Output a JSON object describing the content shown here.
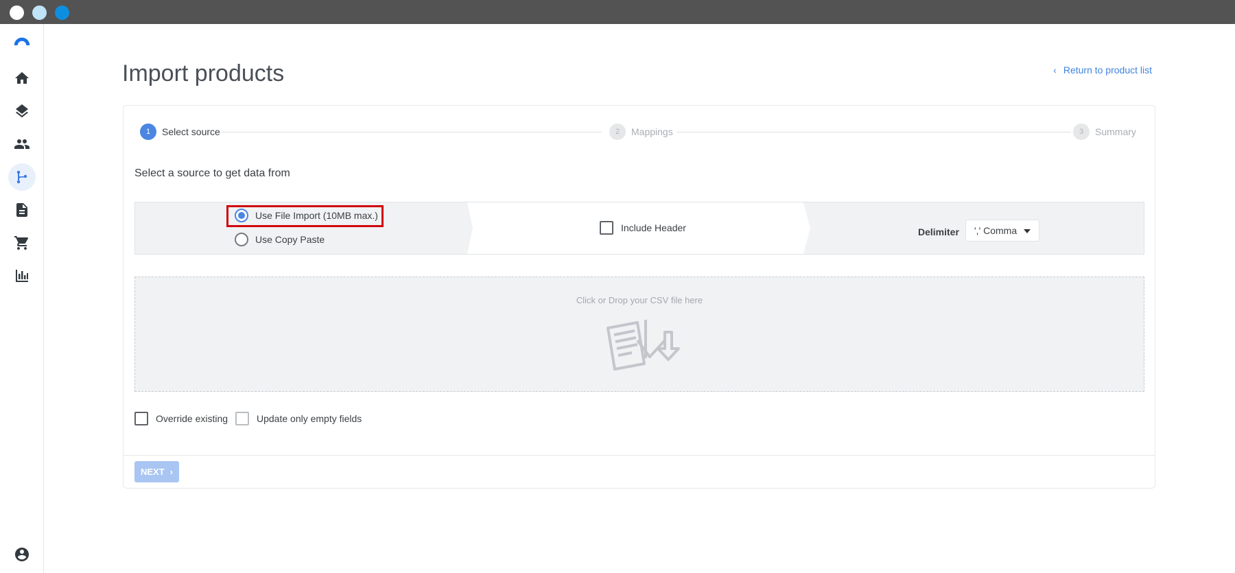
{
  "window": {
    "controls": [
      "close",
      "minimize",
      "maximize"
    ]
  },
  "sidebar": {
    "items": [
      {
        "icon": "logo-icon"
      },
      {
        "icon": "home-icon"
      },
      {
        "icon": "layers-icon"
      },
      {
        "icon": "people-icon"
      },
      {
        "icon": "merge-icon",
        "active": true
      },
      {
        "icon": "document-icon"
      },
      {
        "icon": "cart-icon"
      },
      {
        "icon": "bar-chart-icon"
      }
    ],
    "footer_icon": "account-icon"
  },
  "header": {
    "title": "Import products",
    "return_link": "Return to product list"
  },
  "stepper": {
    "steps": [
      {
        "number": "1",
        "label": "Select source",
        "state": "active"
      },
      {
        "number": "2",
        "label": "Mappings",
        "state": "inactive"
      },
      {
        "number": "3",
        "label": "Summary",
        "state": "inactive"
      }
    ]
  },
  "source": {
    "heading": "Select a source to get data from",
    "options": [
      {
        "label": "Use File Import (10MB max.)",
        "checked": true
      },
      {
        "label": "Use Copy Paste",
        "checked": false
      }
    ],
    "include_header_label": "Include Header",
    "include_header_checked": false,
    "delimiter_label": "Delimiter",
    "delimiter_value": "',' Comma"
  },
  "dropzone": {
    "text": "Click or Drop your CSV file here"
  },
  "options": {
    "override_label": "Override existing",
    "update_empty_label": "Update only empty fields"
  },
  "footer": {
    "next_label": "NEXT"
  },
  "colors": {
    "accent": "#4a86e2",
    "highlight": "#d0050c",
    "disabled_button": "#a9c5f2"
  }
}
